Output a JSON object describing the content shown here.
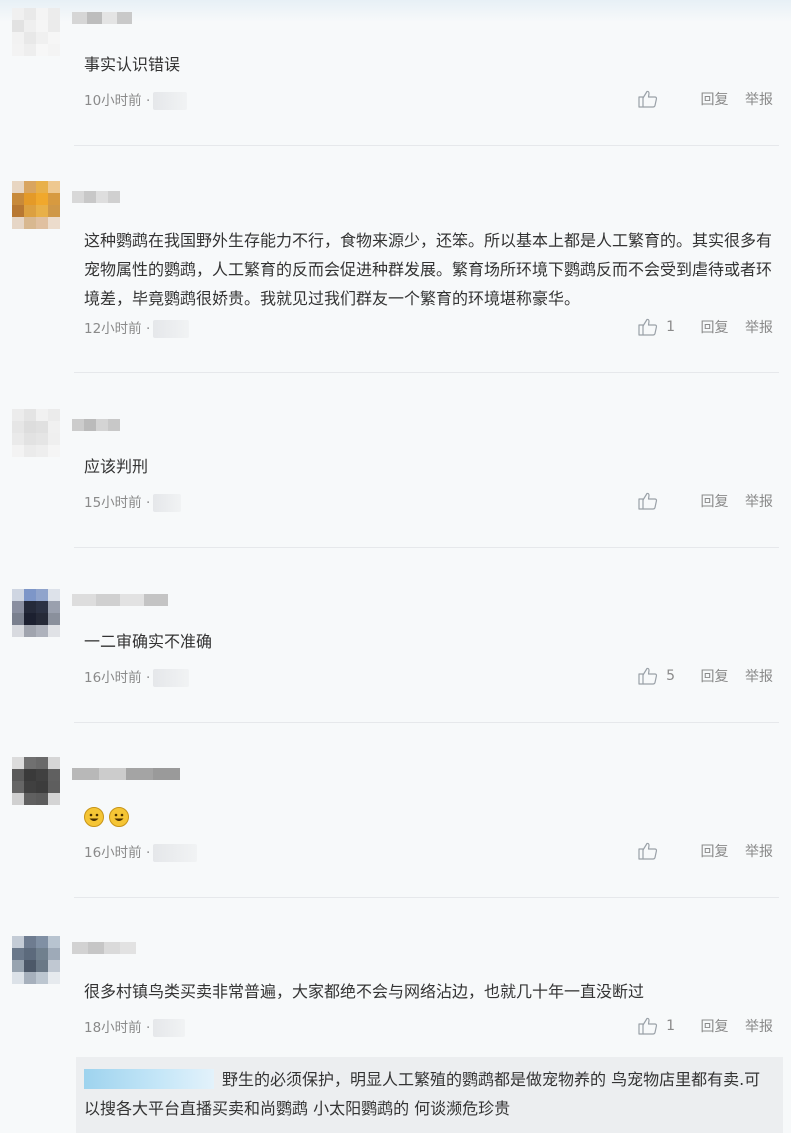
{
  "like_icon": "thumbs-up-icon",
  "reply_label": "回复",
  "report_label": "举报",
  "comments": [
    {
      "text": "事实认识错误",
      "time": "10小时前 ·",
      "likes": "",
      "avatar_colors": [
        "#f0f0f0",
        "#e9e9e9",
        "#f4f4f4",
        "#ececec",
        "#e2e2e2",
        "#efefef",
        "#f5f5f5",
        "#ebebeb",
        "#f2f2f2",
        "#e8e8e8",
        "#f0f0f0",
        "#f6f6f6",
        "#f3f3f3",
        "#eeeeee",
        "#f7f7f7",
        "#f4f4f4"
      ],
      "name_colors": [
        "#d6d6d6",
        "#bdbdbd",
        "#e4e4e4",
        "#c9c9c9"
      ]
    },
    {
      "text": "这种鹦鹉在我国野外生存能力不行，食物来源少，还笨。所以基本上都是人工繁育的。其实很多有宠物属性的鹦鹉，人工繁育的反而会促进种群发展。繁育场所环境下鹦鹉反而不会受到虐待或者环境差，毕竟鹦鹉很娇贵。我就见过我们群友一个繁育的环境堪称豪华。",
      "time": "12小时前 ·",
      "likes": "1",
      "avatar_colors": [
        "#e8d6c2",
        "#d9a560",
        "#e8b04a",
        "#eec890",
        "#c88a3a",
        "#e49a28",
        "#f0a82c",
        "#d79a40",
        "#b87832",
        "#dca040",
        "#e8b048",
        "#cf9848",
        "#e6d6c6",
        "#d8b890",
        "#e0c0a0",
        "#ecdccc"
      ],
      "name_colors": [
        "#d8d8d8",
        "#c8c8c8",
        "#dedede",
        "#d0d0d0"
      ]
    },
    {
      "text": "应该判刑",
      "time": "15小时前 ·",
      "likes": "",
      "avatar_colors": [
        "#ececec",
        "#e4e4e4",
        "#f1f1f1",
        "#ebebeb",
        "#e6e6e6",
        "#dddddd",
        "#e0e0e0",
        "#f0f0f0",
        "#eaeaea",
        "#e2e2e2",
        "#e5e5e5",
        "#efefef",
        "#f3f3f3",
        "#ebebeb",
        "#eeeeee",
        "#f5f5f5"
      ],
      "name_colors": [
        "#cccccc",
        "#bbbbbb",
        "#d4d4d4",
        "#c8c8c8"
      ]
    },
    {
      "text": "一二审确实不准确",
      "time": "16小时前 ·",
      "likes": "5",
      "avatar_colors": [
        "#cfd6e2",
        "#7d96c8",
        "#90a4cc",
        "#dde2ea",
        "#8a8fa0",
        "#252a3a",
        "#2c3244",
        "#9aa0ae",
        "#7a808e",
        "#1c2030",
        "#262a38",
        "#8a909c",
        "#d8dadf",
        "#a0a4ae",
        "#aeb2bc",
        "#e0e2e6"
      ],
      "name_colors": [
        "#dddddd",
        "#d0d0d0",
        "#e2e2e2",
        "#c4c4c4"
      ]
    },
    {
      "emojis": [
        "grinning-face-emoji",
        "grinning-face-emoji"
      ],
      "time": "16小时前 ·",
      "likes": "",
      "avatar_colors": [
        "#dcdcdc",
        "#707070",
        "#6a6a6a",
        "#d6d6d6",
        "#5a5a5a",
        "#3a3a3a",
        "#404040",
        "#606060",
        "#666666",
        "#404040",
        "#3c3c3c",
        "#5e5e5e",
        "#d0d0d0",
        "#606060",
        "#5c5c5c",
        "#d4d4d4"
      ],
      "name_colors": [
        "#b8b8b8",
        "#cccccc",
        "#a4a4a4",
        "#9a9a9a"
      ]
    },
    {
      "text": "很多村镇鸟类买卖非常普遍，大家都绝不会与网络沾边，也就几十年一直没断过",
      "time": "18小时前 ·",
      "likes": "1",
      "avatar_colors": [
        "#c4ccd6",
        "#6e7c90",
        "#8090a4",
        "#b8c4d0",
        "#6a788a",
        "#5c6a7c",
        "#70808e",
        "#9eaab8",
        "#98a4b0",
        "#4c5868",
        "#6a7886",
        "#c0c8d2",
        "#dce2e8",
        "#a6b0bc",
        "#bcc6d0",
        "#e6eaee"
      ],
      "name_colors": [
        "#d2d2d2",
        "#c6c6c6",
        "#dadada",
        "#e2e2e2"
      ]
    }
  ],
  "reply": {
    "text": "野生的必须保护，明显人工繁殖的鹦鹉都是做宠物养的 鸟宠物店里都有卖.可以搜各大平台直播买卖和尚鹦鹉 小太阳鹦鹉的 何谈濒危珍贵"
  }
}
